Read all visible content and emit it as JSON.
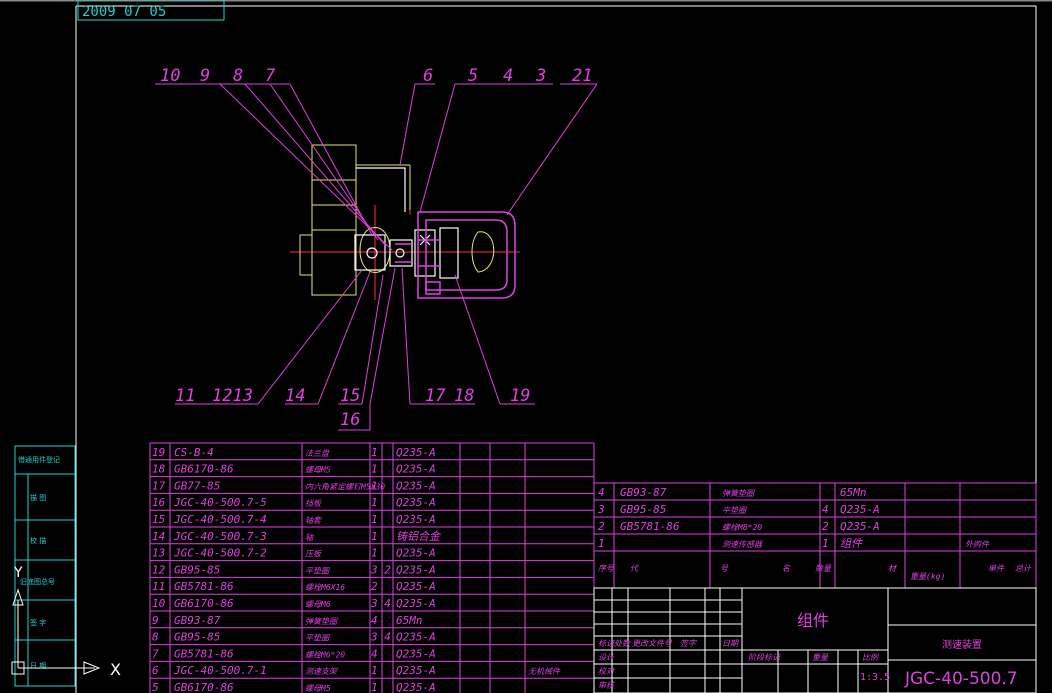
{
  "corner_text": "2009  07  05",
  "leaders_top": [
    "10",
    "9",
    "8",
    "7",
    "6",
    "5",
    "4",
    "3",
    "21"
  ],
  "leaders_bottom": [
    "11",
    "1213",
    "14",
    "15",
    "17",
    "18",
    "19"
  ],
  "leader_16": "16",
  "left_strip": [
    "借通用件登记",
    "描 图",
    "校 描",
    "旧底图总号",
    "签 字",
    "日 期"
  ],
  "parts_left": [
    {
      "no": "19",
      "code": "CS-B-4",
      "name": "法兰盘",
      "qty": "1",
      "mat": "Q235-A"
    },
    {
      "no": "18",
      "code": "GB6170-86",
      "name": "螺母M5",
      "qty": "1",
      "mat": "Q235-A"
    },
    {
      "no": "17",
      "code": "GB77-85",
      "name": "内六角紧定螺钉M5X30",
      "qty": "1",
      "mat": "Q235-A"
    },
    {
      "no": "16",
      "code": "JGC-40-500.7-5",
      "name": "挡板",
      "qty": "1",
      "mat": "Q235-A"
    },
    {
      "no": "15",
      "code": "JGC-40-500.7-4",
      "name": "轴套",
      "qty": "1",
      "mat": "Q235-A"
    },
    {
      "no": "14",
      "code": "JGC-40-500.7-3",
      "name": "轴",
      "qty": "1",
      "mat": "铸铝合金"
    },
    {
      "no": "13",
      "code": "JGC-40-500.7-2",
      "name": "压板",
      "qty": "1",
      "mat": "Q235-A"
    },
    {
      "no": "12",
      "code": "GB95-85",
      "name": "平垫圈",
      "qty": "3 2",
      "mat": "Q235-A"
    },
    {
      "no": "11",
      "code": "GB5781-86",
      "name": "螺栓M6X16",
      "qty": "2",
      "mat": "Q235-A"
    },
    {
      "no": "10",
      "code": "GB6170-86",
      "name": "螺母M6",
      "qty": "3 4",
      "mat": "Q235-A"
    },
    {
      "no": "9",
      "code": "GB93-87",
      "name": "弹簧垫圈",
      "qty": "4",
      "mat": "65Mn"
    },
    {
      "no": "8",
      "code": "GB95-85",
      "name": "平垫圈",
      "qty": "3 4",
      "mat": "Q235-A"
    },
    {
      "no": "7",
      "code": "GB5781-86",
      "name": "螺栓M6*20",
      "qty": "4",
      "mat": "Q235-A"
    },
    {
      "no": "6",
      "code": "JGC-40-500.7-1",
      "name": "测速支架",
      "qty": "1",
      "mat": "Q235-A"
    },
    {
      "no": "5",
      "code": "GB6170-86",
      "name": "螺母M5",
      "qty": "1",
      "mat": "Q235-A"
    }
  ],
  "parts_left_remark": "无机械件",
  "parts_right": [
    {
      "no": "4",
      "code": "GB93-87",
      "name": "弹簧垫圈",
      "qty": "",
      "mat": "65Mn"
    },
    {
      "no": "3",
      "code": "GB95-85",
      "name": "平垫圈",
      "qty": "4",
      "mat": "Q235-A"
    },
    {
      "no": "2",
      "code": "GB5781-86",
      "name": "螺栓M8*20",
      "qty": "2",
      "mat": "Q235-A"
    },
    {
      "no": "1",
      "code": "",
      "name": "测速传感器",
      "qty": "1",
      "mat": "组件"
    }
  ],
  "parts_right_remark": "外购件",
  "header": {
    "no": "序号",
    "code": "代",
    "num": "号",
    "name": "名",
    "qty": "数量",
    "mat": "材",
    "weight": "重量(kg)",
    "single": "单件",
    "total": "总计"
  },
  "title_block": {
    "assembly": "组件",
    "drawing_name": "测速装置",
    "drawing_no": "JGC-40-500.7",
    "scale": "1:3.5",
    "sign_rows": [
      "设计",
      "校对",
      "审核"
    ],
    "sign_cols": [
      "标记",
      "处数",
      "更改文件号",
      "签字",
      "日期"
    ],
    "meta": [
      "阶段标记",
      "重量",
      "比例"
    ]
  },
  "ucs": {
    "x": "X",
    "y": "Y"
  }
}
